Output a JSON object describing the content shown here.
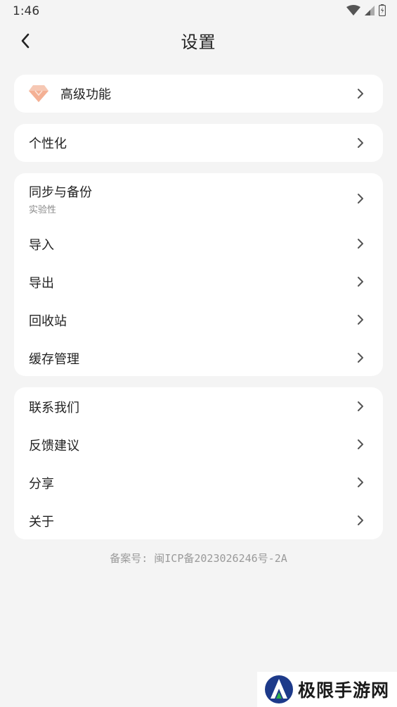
{
  "status_bar": {
    "time": "1:46",
    "icons": [
      "wifi-icon",
      "signal-icon",
      "battery-icon"
    ]
  },
  "header": {
    "title": "设置",
    "back_icon": "chevron-left-icon"
  },
  "premium": {
    "label": "高级功能",
    "icon": "diamond-icon",
    "icon_color": "#f6b9a0"
  },
  "personalize": {
    "label": "个性化"
  },
  "data_group": {
    "items": [
      {
        "label": "同步与备份",
        "sub": "实验性"
      },
      {
        "label": "导入"
      },
      {
        "label": "导出"
      },
      {
        "label": "回收站"
      },
      {
        "label": "缓存管理"
      }
    ]
  },
  "about_group": {
    "items": [
      {
        "label": "联系我们"
      },
      {
        "label": "反馈建议"
      },
      {
        "label": "分享"
      },
      {
        "label": "关于"
      }
    ]
  },
  "footer": {
    "icp": "备案号: 闽ICP备2023026246号-2A"
  },
  "watermark": {
    "text": "极限手游网"
  },
  "colors": {
    "background": "#f4f4f4",
    "card": "#ffffff",
    "text": "#222222",
    "subtext": "#8a8a8a",
    "chevron": "#555555"
  }
}
